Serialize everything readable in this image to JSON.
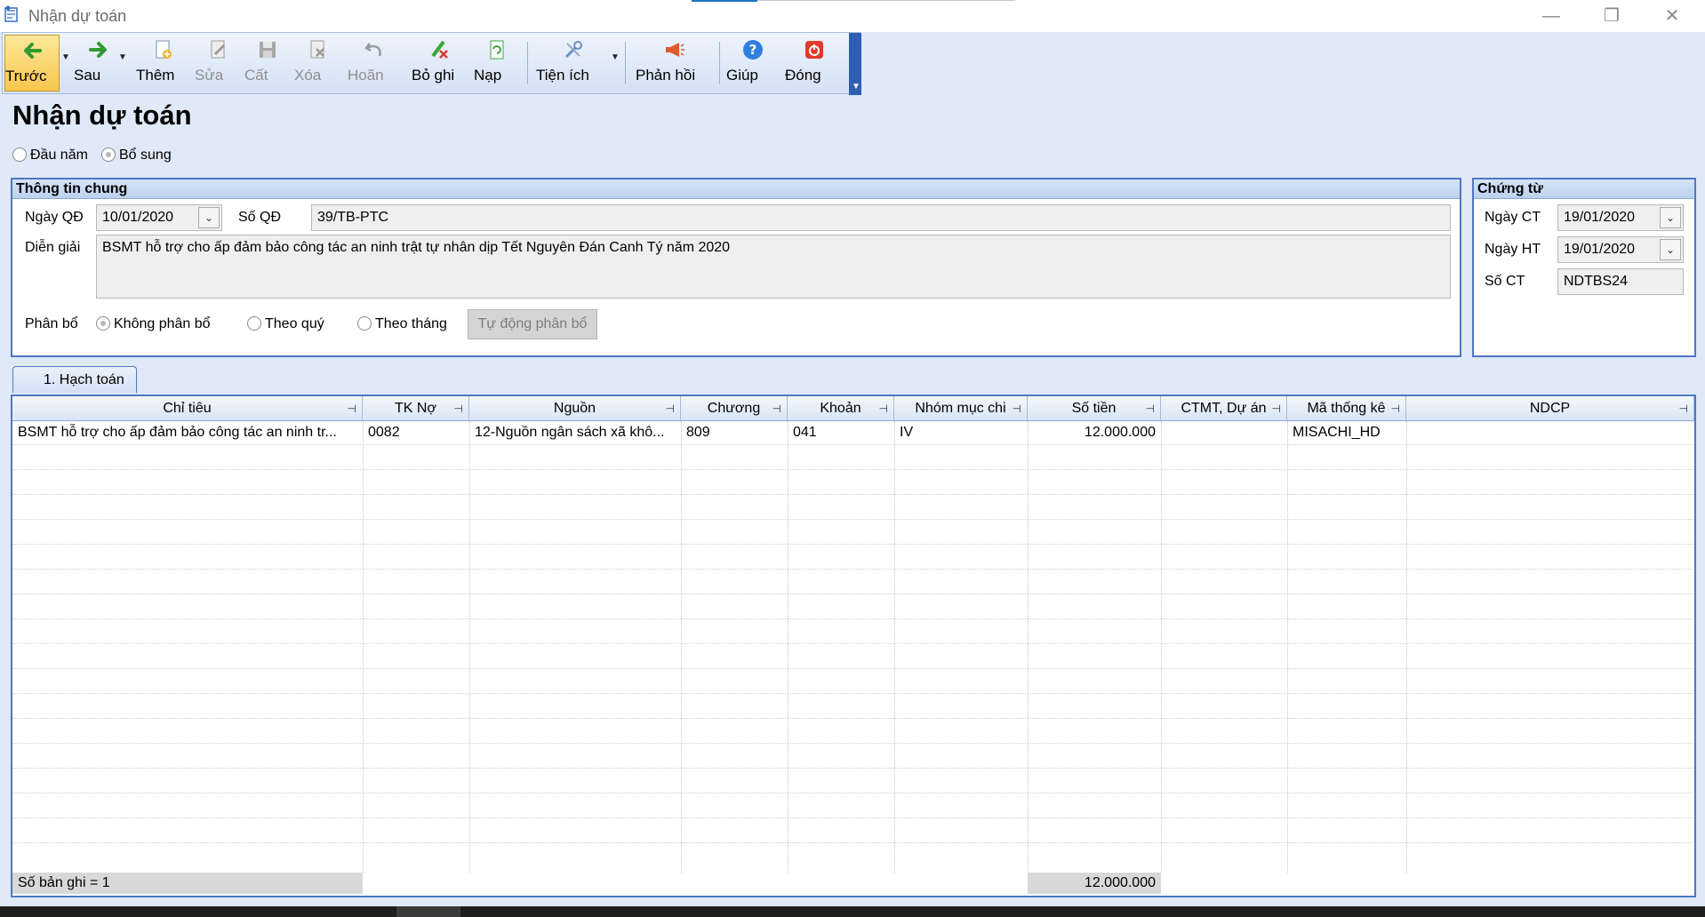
{
  "window": {
    "title": "Nhận dự toán",
    "minimize_glyph": "—",
    "restore_glyph": "❐",
    "close_glyph": "✕"
  },
  "toolbar": {
    "items": [
      {
        "label": "Trước",
        "icon": "back-arrow-icon",
        "enabled": true,
        "active": true
      },
      {
        "label": "Sau",
        "icon": "forward-arrow-icon",
        "enabled": true
      },
      {
        "label": "Thêm",
        "icon": "add-document-icon",
        "enabled": true
      },
      {
        "label": "Sửa",
        "icon": "edit-document-icon",
        "enabled": false
      },
      {
        "label": "Cất",
        "icon": "save-icon",
        "enabled": false
      },
      {
        "label": "Xóa",
        "icon": "delete-document-icon",
        "enabled": false
      },
      {
        "label": "Hoãn",
        "icon": "undo-icon",
        "enabled": false
      },
      {
        "label": "Bỏ ghi",
        "icon": "unpost-icon",
        "enabled": true
      },
      {
        "label": "Nạp",
        "icon": "refresh-icon",
        "enabled": true
      },
      {
        "label": "Tiện ích",
        "icon": "tools-icon",
        "enabled": true
      },
      {
        "label": "Phản hồi",
        "icon": "megaphone-icon",
        "enabled": true
      },
      {
        "label": "Giúp",
        "icon": "help-icon",
        "enabled": true
      },
      {
        "label": "Đóng",
        "icon": "close-power-icon",
        "enabled": true
      }
    ]
  },
  "page_title": "Nhận dự toán",
  "type_options": {
    "dau_nam": "Đầu năm",
    "bo_sung": "Bổ sung",
    "selected": "Bổ sung"
  },
  "general_info": {
    "header": "Thông tin chung",
    "ngay_qd_label": "Ngày QĐ",
    "ngay_qd_value": "10/01/2020",
    "so_qd_label": "Số QĐ",
    "so_qd_value": "39/TB-PTC",
    "dien_giai_label": "Diễn giải",
    "dien_giai_value": "BSMT hỗ trợ cho ấp đảm bảo công tác an ninh trật tự nhân dịp Tết Nguyên Đán Canh Tý năm 2020",
    "phan_bo_label": "Phân bổ",
    "phan_bo_options": [
      "Không phân bổ",
      "Theo quý",
      "Theo tháng"
    ],
    "phan_bo_selected": "Không phân bổ",
    "auto_allocate_button": "Tự động phân bổ"
  },
  "voucher": {
    "header": "Chứng từ",
    "ngay_ct_label": "Ngày CT",
    "ngay_ct_value": "19/01/2020",
    "ngay_ht_label": "Ngày HT",
    "ngay_ht_value": "19/01/2020",
    "so_ct_label": "Số CT",
    "so_ct_value": "NDTBS24"
  },
  "tab": {
    "label": "1. Hạch toán"
  },
  "grid": {
    "columns": [
      "Chỉ tiêu",
      "TK Nợ",
      "Nguồn",
      "Chương",
      "Khoản",
      "Nhóm mục chi",
      "Số tiền",
      "CTMT, Dự án",
      "Mã thống kê",
      "NDCP"
    ],
    "rows": [
      [
        "BSMT hỗ trợ cho ấp đảm bảo công tác an ninh tr...",
        "0082",
        "12-Nguồn ngân sách xã khô...",
        "809",
        "041",
        "IV",
        "12.000.000",
        "",
        "MISACHI_HD",
        ""
      ]
    ],
    "footer_count": "Số bản ghi = 1",
    "footer_total": "12.000.000"
  }
}
